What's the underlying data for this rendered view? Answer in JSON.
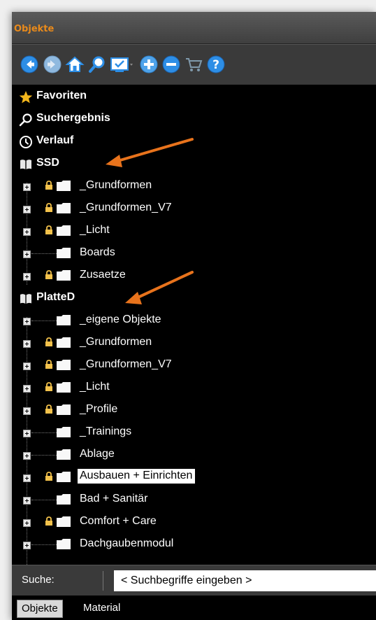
{
  "window": {
    "title": "Objekte"
  },
  "toolbar": {
    "buttons": [
      {
        "name": "back-icon",
        "color": "#2d8ee6"
      },
      {
        "name": "forward-icon",
        "color": "#8fb9df"
      },
      {
        "name": "home-icon",
        "color": "#2d8ee6"
      },
      {
        "name": "search-icon",
        "color": "#2d8ee6"
      },
      {
        "name": "display-icon",
        "color": "#2d8ee6"
      },
      {
        "name": "plus-icon",
        "color": "#4fa3ea"
      },
      {
        "name": "minus-icon",
        "color": "#2d8ee6"
      },
      {
        "name": "cart-icon",
        "color": "#7f99ab"
      },
      {
        "name": "help-icon",
        "color": "#2d8ee6"
      }
    ]
  },
  "tree": {
    "favorites": "Favoriten",
    "search_results": "Suchergebnis",
    "history": "Verlauf",
    "ssd": {
      "label": "SSD",
      "items": [
        {
          "label": "_Grundformen",
          "locked": true
        },
        {
          "label": "_Grundformen_V7",
          "locked": true
        },
        {
          "label": "_Licht",
          "locked": true
        },
        {
          "label": "Boards",
          "locked": false
        },
        {
          "label": "Zusaetze",
          "locked": true
        }
      ]
    },
    "platted": {
      "label": "PlatteD",
      "items": [
        {
          "label": "_eigene Objekte",
          "locked": false
        },
        {
          "label": "_Grundformen",
          "locked": true
        },
        {
          "label": "_Grundformen_V7",
          "locked": true
        },
        {
          "label": "_Licht",
          "locked": true
        },
        {
          "label": "_Profile",
          "locked": true
        },
        {
          "label": "_Trainings",
          "locked": false
        },
        {
          "label": "Ablage",
          "locked": false
        },
        {
          "label": "Ausbauen + Einrichten",
          "locked": true,
          "selected": true
        },
        {
          "label": "Bad + Sanitär",
          "locked": false
        },
        {
          "label": "Comfort + Care",
          "locked": true
        },
        {
          "label": "Dachgaubenmodul",
          "locked": false
        }
      ]
    }
  },
  "search": {
    "label": "Suche:",
    "placeholder": "< Suchbegriffe eingeben >"
  },
  "tabs": [
    {
      "label": "Objekte",
      "active": true
    },
    {
      "label": "Material",
      "active": false
    }
  ],
  "colors": {
    "title": "#e98a1b",
    "arrow": "#e8731c",
    "lock": "#f2c14b",
    "icon_blue": "#2d8ee6"
  }
}
